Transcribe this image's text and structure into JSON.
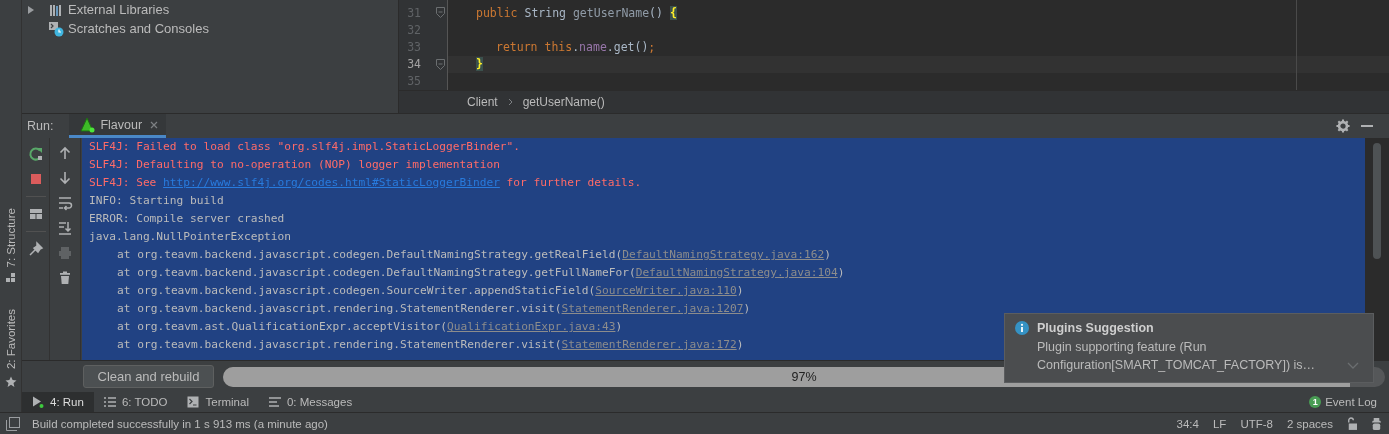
{
  "side_tabs": [
    "7: Structure",
    "2: Favorites"
  ],
  "project_tree": {
    "items": [
      {
        "label": "External Libraries",
        "kind": "library",
        "expanded": false
      },
      {
        "label": "Scratches and Consoles",
        "kind": "scratches"
      }
    ]
  },
  "editor": {
    "lines": [
      {
        "number": "31",
        "current": false,
        "fold": true,
        "indented": false,
        "tokens": [
          {
            "kind": "keyword",
            "text": "public"
          },
          {
            "kind": "plain",
            "text": " String "
          },
          {
            "kind": "method",
            "text": "getUserName"
          },
          {
            "kind": "plain",
            "text": "() "
          },
          {
            "kind": "brace-match",
            "text": "{"
          }
        ]
      },
      {
        "number": "32",
        "current": false,
        "fold": false
      },
      {
        "number": "33",
        "current": false,
        "fold": false,
        "indented": true,
        "tokens": [
          {
            "kind": "keyword",
            "text": "return this"
          },
          {
            "kind": "plain",
            "text": "."
          },
          {
            "kind": "field",
            "text": "name"
          },
          {
            "kind": "plain",
            "text": ".get()"
          },
          {
            "kind": "keyword",
            "text": ";"
          }
        ]
      },
      {
        "number": "34",
        "current": true,
        "fold": true,
        "indented": false,
        "tokens": [
          {
            "kind": "brace-match",
            "text": "}"
          }
        ]
      },
      {
        "number": "35",
        "current": false,
        "fold": false
      }
    ],
    "breadcrumbs": [
      "Client",
      "getUserName()"
    ]
  },
  "run": {
    "label": "Run:",
    "tabs": [
      {
        "label": "Flavour",
        "selected": true
      }
    ]
  },
  "console": {
    "selected": true,
    "lines": [
      {
        "kind": "error",
        "parts": [
          {
            "text": "SLF4J: Failed to load class \"org.slf4j.impl.StaticLoggerBinder\"."
          }
        ]
      },
      {
        "kind": "error",
        "parts": [
          {
            "text": "SLF4J: Defaulting to no-operation (NOP) logger implementation"
          }
        ]
      },
      {
        "kind": "error",
        "parts": [
          {
            "text": "SLF4J: See "
          },
          {
            "text": "http://www.slf4j.org/codes.html#StaticLoggerBinder",
            "link": true
          },
          {
            "text": " for further details."
          }
        ]
      },
      {
        "kind": "info",
        "parts": [
          {
            "text": "INFO: Starting build"
          }
        ]
      },
      {
        "kind": "info",
        "parts": [
          {
            "text": "ERROR: Compile server crashed"
          }
        ]
      },
      {
        "kind": "info",
        "parts": [
          {
            "text": "java.lang.NullPointerException"
          }
        ]
      },
      {
        "kind": "trace",
        "parts": [
          {
            "text": "at org.teavm.backend.javascript.codegen.DefaultNamingStrategy.getRealField("
          },
          {
            "text": "DefaultNamingStrategy.java:162",
            "link": true
          },
          {
            "text": ")"
          }
        ]
      },
      {
        "kind": "trace",
        "parts": [
          {
            "text": "at org.teavm.backend.javascript.codegen.DefaultNamingStrategy.getFullNameFor("
          },
          {
            "text": "DefaultNamingStrategy.java:104",
            "link": true
          },
          {
            "text": ")"
          }
        ]
      },
      {
        "kind": "trace",
        "parts": [
          {
            "text": "at org.teavm.backend.javascript.codegen.SourceWriter.appendStaticField("
          },
          {
            "text": "SourceWriter.java:110",
            "link": true
          },
          {
            "text": ")"
          }
        ]
      },
      {
        "kind": "trace",
        "parts": [
          {
            "text": "at org.teavm.backend.javascript.rendering.StatementRenderer.visit("
          },
          {
            "text": "StatementRenderer.java:1207",
            "link": true
          },
          {
            "text": ")"
          }
        ]
      },
      {
        "kind": "trace",
        "parts": [
          {
            "text": "at org.teavm.ast.QualificationExpr.acceptVisitor("
          },
          {
            "text": "QualificationExpr.java:43",
            "link": true
          },
          {
            "text": ")"
          }
        ]
      },
      {
        "kind": "trace",
        "parts": [
          {
            "text": "at org.teavm.backend.javascript.rendering.StatementRenderer.visit("
          },
          {
            "text": "StatementRenderer.java:172",
            "link": true
          },
          {
            "text": ")"
          }
        ]
      }
    ]
  },
  "footer": {
    "button": "Clean and rebuild",
    "progress": {
      "level": 0.97,
      "text": "97%"
    }
  },
  "notification": {
    "title": "Plugins Suggestion",
    "text": "Plugin supporting feature (Run Configuration[SMART_TOMCAT_FACTORY]) is…"
  },
  "tool_windows": [
    {
      "label": "4: Run",
      "selected": true
    },
    {
      "label": "6: TODO",
      "selected": false
    },
    {
      "label": "Terminal",
      "selected": false
    },
    {
      "label": "0: Messages",
      "selected": false
    }
  ],
  "event_log": {
    "count": "1",
    "label": "Event Log"
  },
  "status_bar": {
    "message": "Build completed successfully in 1 s 913 ms (a minute ago)",
    "items": [
      "34:4",
      "LF",
      "UTF-8",
      "2 spaces"
    ]
  }
}
